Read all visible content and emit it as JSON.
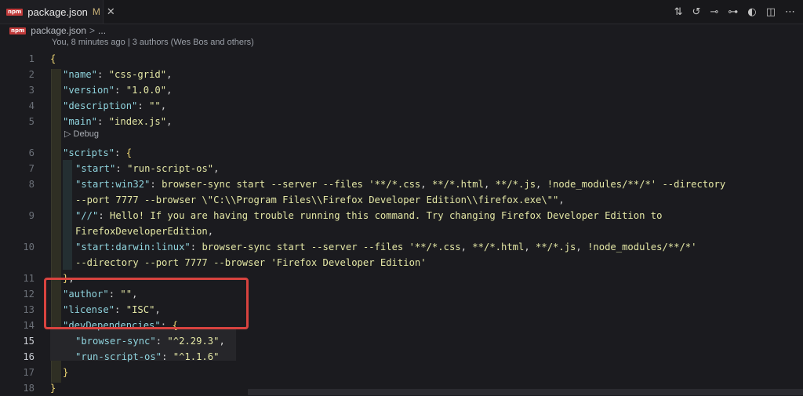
{
  "tab": {
    "label": "package.json",
    "modified": "M",
    "close": "✕",
    "icon_text": "npm"
  },
  "actions": [
    "source-control-icon",
    "go-back-icon",
    "go-forward-icon",
    "open-changes-icon",
    "copilot-icon",
    "split-editor-icon",
    "more-actions-icon"
  ],
  "breadcrumb": {
    "file": "package.json",
    "sep": ">",
    "more": "..."
  },
  "blame": "You, 8 minutes ago | 3 authors (Wes Bos and others)",
  "codelens": "▷ Debug",
  "lines": [
    {
      "n": "1",
      "text": "{"
    },
    {
      "n": "2",
      "text": "\"name\": \"css-grid\","
    },
    {
      "n": "3",
      "text": "\"version\": \"1.0.0\","
    },
    {
      "n": "4",
      "text": "\"description\": \"\","
    },
    {
      "n": "5",
      "text": "\"main\": \"index.js\","
    },
    {
      "n": "6",
      "text": "\"scripts\": {"
    },
    {
      "n": "7",
      "text": "\"start\": \"run-script-os\","
    },
    {
      "n": "8",
      "text": "\"start:win32\": \"browser-sync start --server --files '**/*.css, **/*.html, **/*.js, !node_modules/**/*' --directory"
    },
    {
      "n": "",
      "text": "--port 7777 --browser \\\"C:\\\\Program Files\\\\Firefox Developer Edition\\\\firefox.exe\\\"\","
    },
    {
      "n": "9",
      "text": "\"//\": \"Hello! If you are having trouble running this command. Try changing Firefox Developer Edition to"
    },
    {
      "n": "",
      "text": "FirefoxDeveloperEdition\","
    },
    {
      "n": "10",
      "text": "\"start:darwin:linux\": \"browser-sync start --server --files '**/*.css, **/*.html, **/*.js, !node_modules/**/*'"
    },
    {
      "n": "",
      "text": "--directory --port 7777 --browser 'Firefox Developer Edition'\""
    },
    {
      "n": "11",
      "text": "},"
    },
    {
      "n": "12",
      "text": "\"author\": \"\","
    },
    {
      "n": "13",
      "text": "\"license\": \"ISC\","
    },
    {
      "n": "14",
      "text": "\"devDependencies\": {"
    },
    {
      "n": "15",
      "text": "\"browser-sync\": \"^2.29.3\","
    },
    {
      "n": "16",
      "text": "\"run-script-os\": \"^1.1.6\""
    },
    {
      "n": "17",
      "text": "}"
    },
    {
      "n": "18",
      "text": "}"
    }
  ]
}
